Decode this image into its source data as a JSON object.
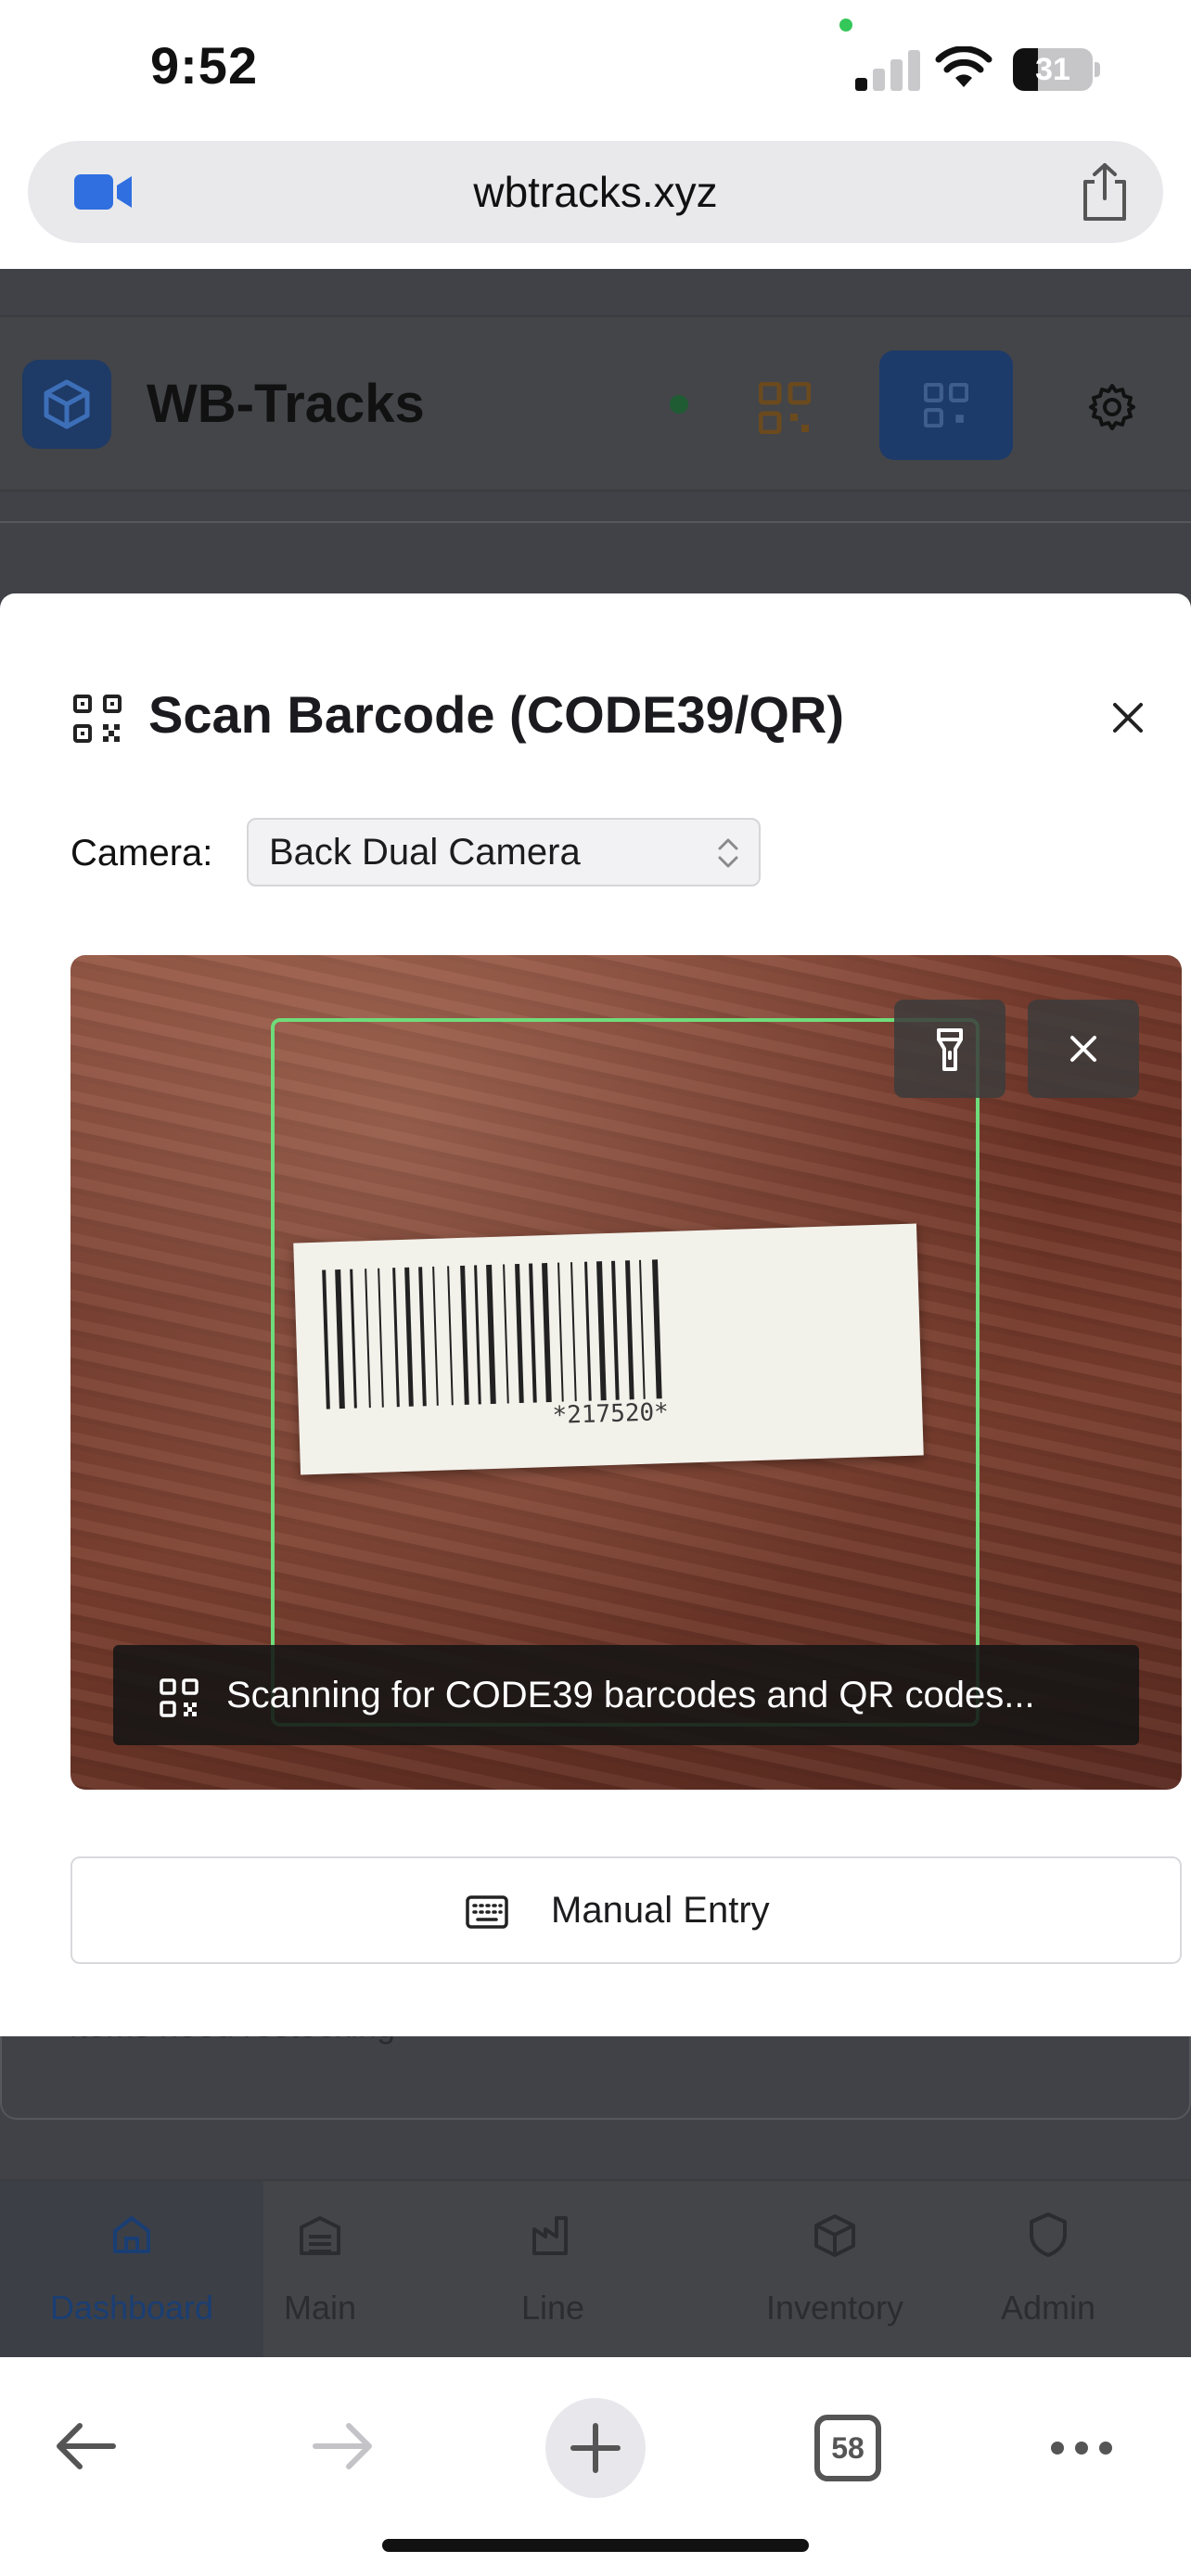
{
  "status_bar": {
    "time": "9:52",
    "battery": "31",
    "battery_level": 0.31
  },
  "browser": {
    "url": "wbtracks.xyz",
    "tab_count": "58"
  },
  "app": {
    "title": "WB-Tracks",
    "background_text": "Items need restocking",
    "nav": [
      {
        "label": "Dashboard",
        "icon": "home-icon"
      },
      {
        "label": "Main",
        "icon": "warehouse-icon"
      },
      {
        "label": "Line",
        "icon": "factory-icon"
      },
      {
        "label": "Inventory",
        "icon": "box-icon"
      },
      {
        "label": "Admin",
        "icon": "shield-icon"
      }
    ]
  },
  "modal": {
    "title": "Scan Barcode (CODE39/QR)",
    "camera_label": "Camera:",
    "camera_value": "Back Dual Camera",
    "barcode_number": "*217520*",
    "scan_status": "Scanning for CODE39 barcodes and QR codes...",
    "manual_entry_label": "Manual Entry"
  },
  "colors": {
    "accent": "#1c3a6a",
    "scan_frame": "#6fdc7a",
    "connected": "#34c759"
  }
}
